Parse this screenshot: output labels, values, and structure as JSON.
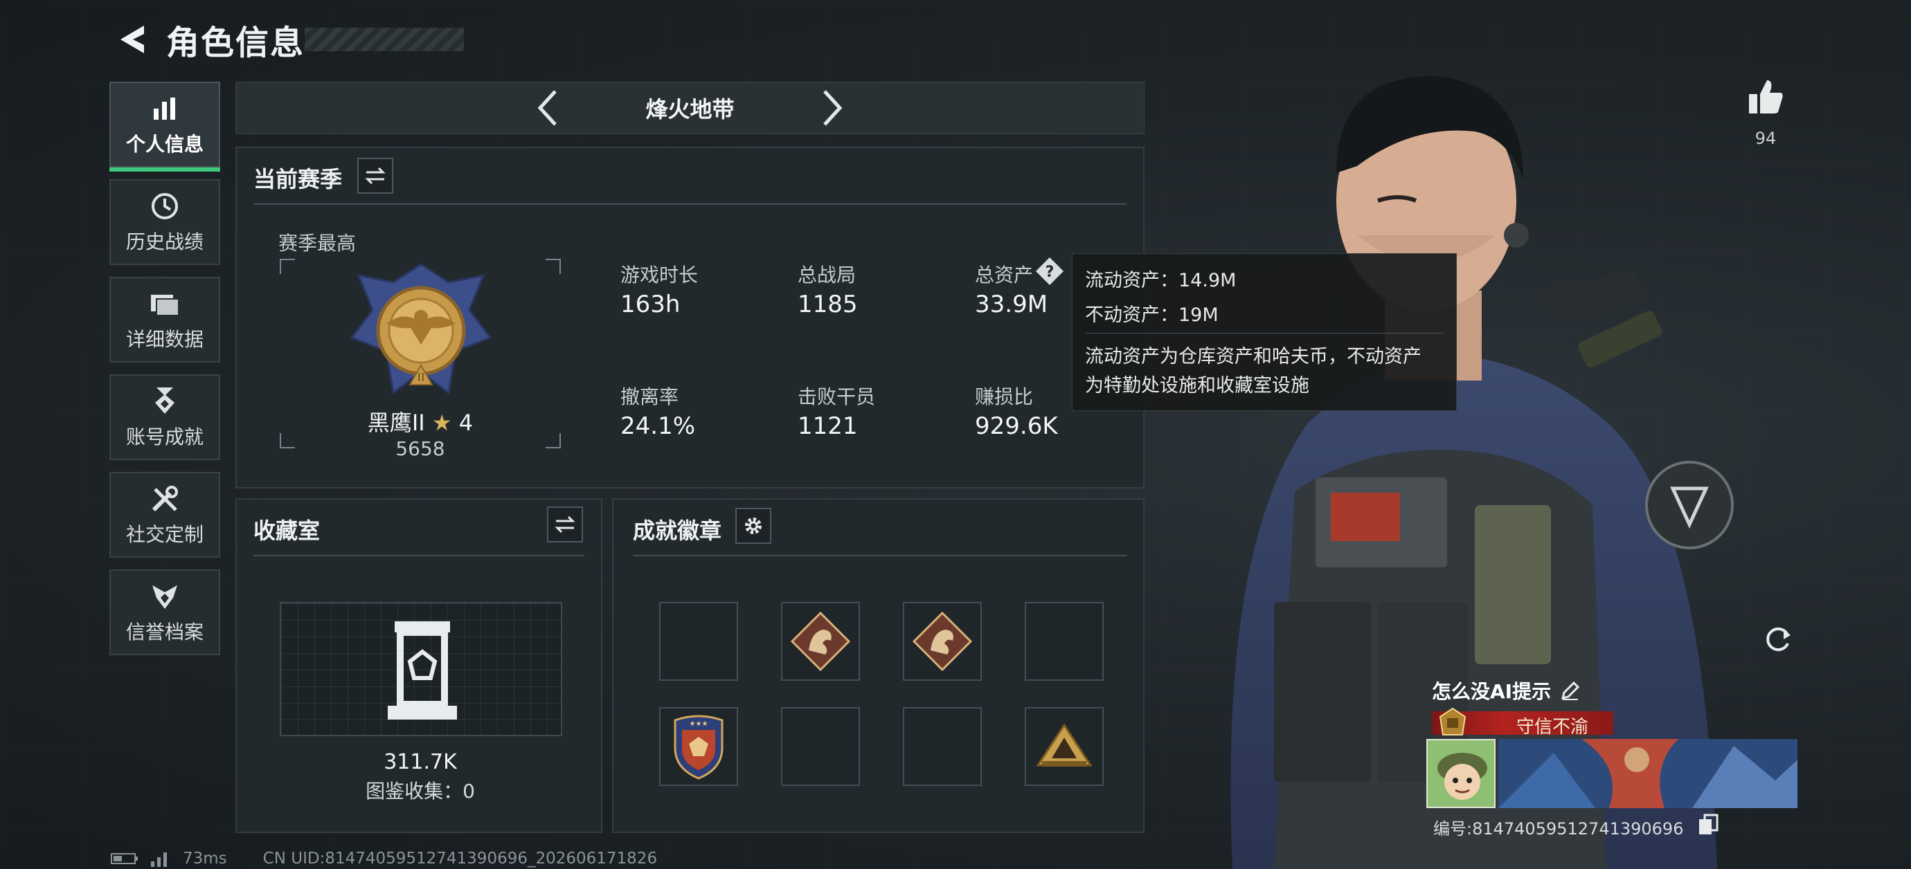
{
  "header": {
    "title": "角色信息"
  },
  "sidebar": {
    "items": [
      {
        "label": "个人信息",
        "icon": "bar-chart-icon",
        "active": true
      },
      {
        "label": "历史战绩",
        "icon": "clock-icon"
      },
      {
        "label": "详细数据",
        "icon": "folder-icon"
      },
      {
        "label": "账号成就",
        "icon": "medal-icon"
      },
      {
        "label": "社交定制",
        "icon": "tools-icon"
      },
      {
        "label": "信誉档案",
        "icon": "reputation-icon"
      }
    ]
  },
  "mode": {
    "title": "烽火地带"
  },
  "season": {
    "title": "当前赛季",
    "best_label": "赛季最高",
    "rank_name": "黑鹰II",
    "rank_stars": "4",
    "rank_score": "5658",
    "stats": [
      {
        "label": "游戏时长",
        "value": "163h"
      },
      {
        "label": "总战局",
        "value": "1185"
      },
      {
        "label": "总资产",
        "value": "33.9M"
      },
      {
        "label": "撤离率",
        "value": "24.1%"
      },
      {
        "label": "击败干员",
        "value": "1121"
      },
      {
        "label": "赚损比",
        "value": "929.6K"
      }
    ]
  },
  "tooltip": {
    "line1": "流动资产：14.9M",
    "line2": "不动资产：19M",
    "desc1": "流动资产为仓库资产和哈夫币，不动资产",
    "desc2": "为特勤处设施和收藏室设施"
  },
  "collection": {
    "title": "收藏室",
    "value": "311.7K",
    "catalog": "图鉴收集：0"
  },
  "achievements": {
    "title": "成就徽章",
    "slots": [
      "empty",
      "dragon-badge",
      "dragon-badge",
      "empty",
      "shield-badge",
      "empty",
      "empty",
      "pyramid-badge"
    ]
  },
  "profile": {
    "likes": "94",
    "name": "怎么没AI提示",
    "title": "守信不渝",
    "uid": "编号:814740595127413906​96"
  },
  "footer": {
    "ping": "73ms",
    "uid": "CN UID:81474059512741390696_202606171826"
  }
}
